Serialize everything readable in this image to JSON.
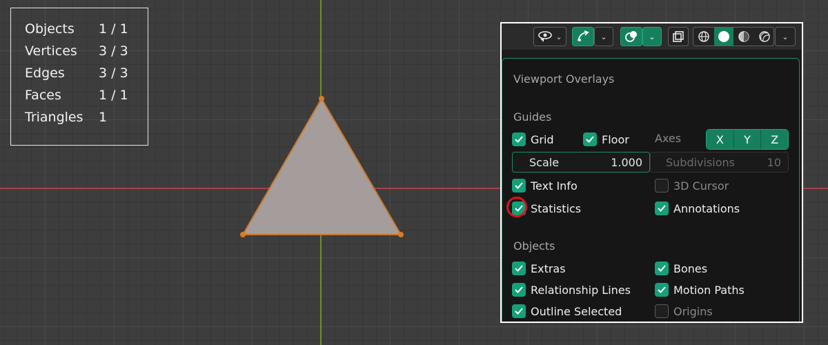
{
  "stats": {
    "objects_label": "Objects",
    "objects_value": "1 / 1",
    "vertices_label": "Vertices",
    "vertices_value": "3 / 3",
    "edges_label": "Edges",
    "edges_value": "3 / 3",
    "faces_label": "Faces",
    "faces_value": "1 / 1",
    "triangles_label": "Triangles",
    "triangles_value": "1"
  },
  "header_icons": [
    "visibility-icon",
    "gizmo-icon",
    "overlays-icon",
    "xray-icon",
    "wireframe-shading-icon",
    "solid-shading-icon",
    "material-shading-icon",
    "rendered-shading-icon"
  ],
  "overlay_popup": {
    "title": "Viewport Overlays",
    "guides_heading": "Guides",
    "grid": {
      "label": "Grid",
      "checked": true
    },
    "floor": {
      "label": "Floor",
      "checked": true
    },
    "axes_label": "Axes",
    "axes": [
      "X",
      "Y",
      "Z"
    ],
    "scale_label": "Scale",
    "scale_value": "1.000",
    "subdivisions_label": "Subdivisions",
    "subdivisions_value": "10",
    "text_info": {
      "label": "Text Info",
      "checked": true
    },
    "cursor_3d": {
      "label": "3D Cursor",
      "checked": false
    },
    "statistics": {
      "label": "Statistics",
      "checked": true
    },
    "annotations": {
      "label": "Annotations",
      "checked": true
    },
    "objects_heading": "Objects",
    "extras": {
      "label": "Extras",
      "checked": true
    },
    "bones": {
      "label": "Bones",
      "checked": true
    },
    "relationship_lines": {
      "label": "Relationship Lines",
      "checked": true
    },
    "motion_paths": {
      "label": "Motion Paths",
      "checked": true
    },
    "outline_selected": {
      "label": "Outline Selected",
      "checked": true
    },
    "origins": {
      "label": "Origins",
      "checked": false
    }
  },
  "colors": {
    "accent": "#16a07a",
    "highlight_ring": "#e0121a",
    "mesh_fill": "#a59d9b",
    "mesh_edge": "#e07a1f"
  }
}
